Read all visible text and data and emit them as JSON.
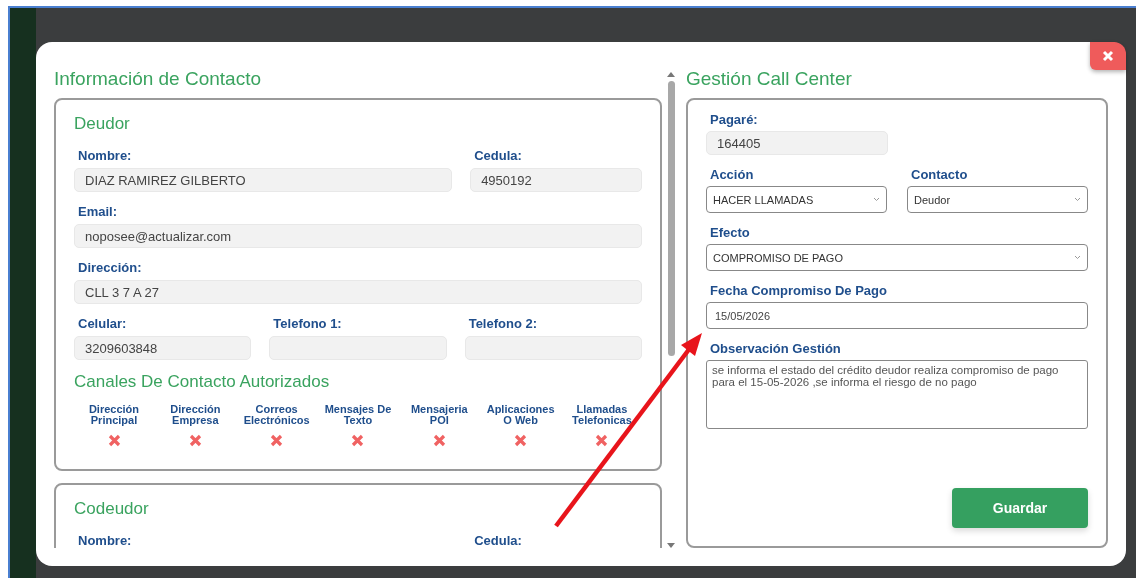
{
  "contact": {
    "title": "Información de Contacto",
    "sections": [
      {
        "title": "Deudor",
        "rows": [
          {
            "fields": [
              {
                "label": "Nombre:",
                "kind": "input",
                "value": "DIAZ RAMIREZ GILBERTO"
              },
              {
                "label": "Cedula:",
                "kind": "input",
                "value": "4950192"
              }
            ]
          },
          {
            "fields": [
              {
                "label": "Email:",
                "kind": "input",
                "value": "noposee@actualizar.com"
              }
            ]
          },
          {
            "fields": [
              {
                "label": "Dirección:",
                "kind": "input",
                "value": "CLL 3 7 A 27"
              }
            ]
          },
          {
            "fields": [
              {
                "label": "Celular:",
                "kind": "input",
                "value": "3209603848"
              },
              {
                "label": "Telefono 1:",
                "kind": "input"
              },
              {
                "label": "Telefono 2:",
                "kind": "input"
              }
            ]
          }
        ],
        "channels_title": "Canales De Contacto Autorizados",
        "channels": [
          {
            "label": "Dirección Principal",
            "authorized": false
          },
          {
            "label": "Dirección Empresa",
            "authorized": false
          },
          {
            "label": "Correos Electrónicos",
            "authorized": false
          },
          {
            "label": "Mensajes De Texto",
            "authorized": false
          },
          {
            "label": "Mensajeria POI",
            "authorized": false
          },
          {
            "label": "Aplicaciones O Web",
            "authorized": false
          },
          {
            "label": "Llamadas Telefonicas",
            "authorized": false
          }
        ]
      },
      {
        "title": "Codeudor",
        "rows": [
          {
            "fields": [
              {
                "label": "Nombre:"
              },
              {
                "label": "Cedula:"
              }
            ]
          }
        ]
      }
    ]
  },
  "call_center": {
    "title": "Gestión Call Center",
    "pagare": {
      "label": "Pagaré:",
      "value": "164405"
    },
    "accion": {
      "label": "Acción",
      "value": "HACER LLAMADAS"
    },
    "contacto": {
      "label": "Contacto",
      "value": "Deudor"
    },
    "efecto": {
      "label": "Efecto",
      "value": "COMPROMISO DE PAGO"
    },
    "fecha": {
      "label": "Fecha Compromiso De Pago",
      "value": "15/05/2026"
    },
    "observacion": {
      "label": "Observación Gestión",
      "value": "se informa el estado del crédito deudor realiza compromiso de pago para el 15-05-2026 ,se informa el riesgo de no pago"
    },
    "save_button": "Guardar"
  }
}
